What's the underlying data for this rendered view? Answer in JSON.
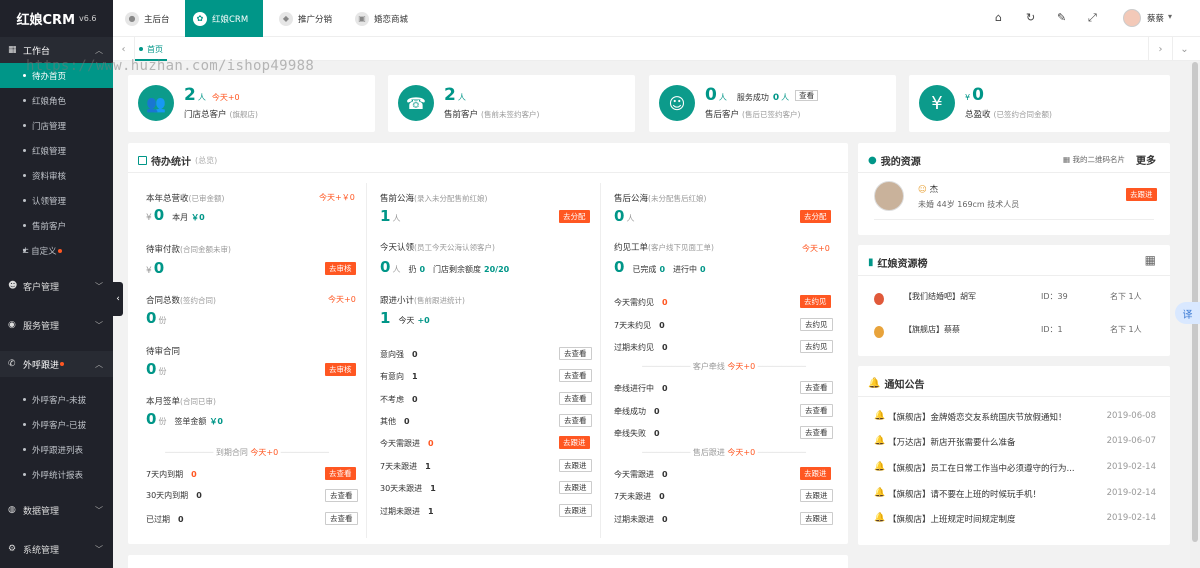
{
  "app": {
    "logo": "红娘CRM",
    "version": "v6.6"
  },
  "sidebar": {
    "groups": [
      {
        "label": "工作台",
        "icon": "grid-icon"
      },
      {
        "label": "客户管理",
        "icon": "user-icon"
      },
      {
        "label": "服务管理",
        "icon": "service-icon"
      },
      {
        "label": "外呼跟进",
        "icon": "phone-icon"
      },
      {
        "label": "数据管理",
        "icon": "data-icon"
      },
      {
        "label": "系统管理",
        "icon": "gear-icon"
      }
    ],
    "workbench_items": [
      "待办首页",
      "红娘角色",
      "门店管理",
      "红娘管理",
      "资料审核",
      "认领管理",
      "售前客户",
      "自定义"
    ],
    "call_items": [
      "外呼客户-未拔",
      "外呼客户-已拔",
      "外呼跟进列表",
      "外呼统计报表"
    ]
  },
  "topbar": {
    "tabs": [
      "主后台",
      "红娘CRM",
      "推广分销",
      "婚恋商城"
    ],
    "user": "蔡蔡"
  },
  "pagetabs": {
    "home": "首页"
  },
  "watermark": "https://www.huzhan.com/ishop49988",
  "stats": [
    {
      "num": "2",
      "unit": "人",
      "inc": "今天+0",
      "label": "门店总客户",
      "note": "(旗舰店)",
      "icon": "users-icon"
    },
    {
      "num": "2",
      "unit": "人",
      "inc": "",
      "label": "售前客户",
      "note": "(售前未签约客户)",
      "icon": "headset-icon"
    },
    {
      "num": "0",
      "unit": "人",
      "extra": "服务成功",
      "extra_val": "0",
      "extra_unit": "人",
      "btn": "查看",
      "label": "售后客户",
      "note": "(售后已签约客户)",
      "icon": "woman-icon"
    },
    {
      "num": "0",
      "unit": "¥",
      "inc": "",
      "label": "总盈收",
      "note": "(已签约合同金额)",
      "icon": "yen-icon"
    }
  ],
  "todo": {
    "title": "待办统计",
    "sub": "(总览)",
    "col1": {
      "annual_label": "本年总营收",
      "annual_note": "(已审金额)",
      "annual_inc": "今天+￥0",
      "annual_val": "0",
      "month_label": "本月",
      "month_val": "￥0",
      "pay_label": "待审付款",
      "pay_note": "(合同金额未审)",
      "pay_val": "0",
      "pay_btn": "去审核",
      "contract_label": "合同总数",
      "contract_note": "(签约合同)",
      "contract_inc": "今天+0",
      "contract_val": "0",
      "contract_unit": "份",
      "pending_label": "待审合同",
      "pending_val": "0",
      "pending_unit": "份",
      "pending_btn": "去审核",
      "sign_label": "本月签单",
      "sign_note": "(合同已审)",
      "sign_val": "0",
      "sign_unit": "份",
      "sign_amount_label": "签单金额",
      "sign_amount": "￥0",
      "expire_title": "到期合同",
      "expire_inc": "今天+0",
      "expire_rows": [
        {
          "label": "7天内到期",
          "val": "0",
          "btn": "去查看"
        },
        {
          "label": "30天内到期",
          "val": "0",
          "btn": "去查看"
        },
        {
          "label": "已过期",
          "val": "0",
          "btn": "去查看"
        }
      ]
    },
    "col2": {
      "sea_label": "售前公海",
      "sea_note": "(录入未分配售前红娘)",
      "sea_val": "1",
      "sea_unit": "人",
      "sea_btn": "去分配",
      "claim_label": "今天认领",
      "claim_note": "(员工今天公海认领客户)",
      "claim_val": "0",
      "claim_unit": "人",
      "claim_owe": "扔",
      "claim_owe_val": "0",
      "claim_quota_label": "门店剩余额度",
      "claim_quota": "20/20",
      "follow_label": "跟进小计",
      "follow_note": "(售前跟进统计)",
      "follow_val": "1",
      "follow_today": "今天",
      "follow_inc": "+0",
      "rows": [
        {
          "label": "意向强",
          "val": "0",
          "btn": "去查看"
        },
        {
          "label": "有意向",
          "val": "1",
          "btn": "去查看"
        },
        {
          "label": "不考虑",
          "val": "0",
          "btn": "去查看"
        },
        {
          "label": "其他",
          "val": "0",
          "btn": "去查看"
        },
        {
          "label": "今天需跟进",
          "val": "0",
          "btn": "去跟进"
        },
        {
          "label": "7天未跟进",
          "val": "1",
          "btn": "去跟进"
        },
        {
          "label": "30天未跟进",
          "val": "1",
          "btn": "去跟进"
        },
        {
          "label": "过期未跟进",
          "val": "1",
          "btn": "去跟进"
        }
      ]
    },
    "col3": {
      "sea_label": "售后公海",
      "sea_note": "(未分配售后红娘)",
      "sea_val": "0",
      "sea_unit": "人",
      "sea_btn": "去分配",
      "meet_label": "约见工单",
      "meet_note": "(客户线下见面工单)",
      "meet_inc": "今天+0",
      "meet_val": "0",
      "meet_done_label": "已完成",
      "meet_done": "0",
      "meet_doing_label": "进行中",
      "meet_doing": "0",
      "meet_rows": [
        {
          "label": "今天需约见",
          "val": "0",
          "btn": "去约见"
        },
        {
          "label": "7天未约见",
          "val": "0",
          "btn": "去约见"
        },
        {
          "label": "过期未约见",
          "val": "0",
          "btn": "去约见"
        }
      ],
      "line_title": "客户牵线",
      "line_inc": "今天+0",
      "line_rows": [
        {
          "label": "牵线进行中",
          "val": "0",
          "btn": "去查看"
        },
        {
          "label": "牵线成功",
          "val": "0",
          "btn": "去查看"
        },
        {
          "label": "牵线失败",
          "val": "0",
          "btn": "去查看"
        }
      ],
      "after_title": "售后跟进",
      "after_inc": "今天+0",
      "after_rows": [
        {
          "label": "今天需跟进",
          "val": "0",
          "btn": "去跟进"
        },
        {
          "label": "7天未跟进",
          "val": "0",
          "btn": "去跟进"
        },
        {
          "label": "过期未跟进",
          "val": "0",
          "btn": "去跟进"
        }
      ]
    }
  },
  "resources": {
    "title": "我的资源",
    "qr_label": "我的二维码名片",
    "more": "更多",
    "name": "杰",
    "desc": "未婚 44岁 169cm 技术人员",
    "btn": "去跟进"
  },
  "ranking": {
    "title": "红娘资源榜",
    "rows": [
      {
        "name": "【我们结婚吧】胡军",
        "id": "ID：39",
        "count": "名下 1人",
        "color": "#e0593a"
      },
      {
        "name": "【旗舰店】蔡蔡",
        "id": "ID：1",
        "count": "名下 1人",
        "color": "#e8a33b"
      }
    ]
  },
  "notices": {
    "title": "通知公告",
    "rows": [
      {
        "text": "【旗舰店】金牌婚恋交友系统国庆节放假通知！",
        "date": "2019-06-08"
      },
      {
        "text": "【万达店】新店开张需要什么准备",
        "date": "2019-06-07"
      },
      {
        "text": "【旗舰店】员工在日常工作当中必须遵守的行为...",
        "date": "2019-02-14"
      },
      {
        "text": "【旗舰店】请不要在上班的时候玩手机！",
        "date": "2019-02-14"
      },
      {
        "text": "【旗舰店】上班规定时间规定制度",
        "date": "2019-02-14"
      }
    ]
  },
  "misc": {
    "translate": "译"
  }
}
